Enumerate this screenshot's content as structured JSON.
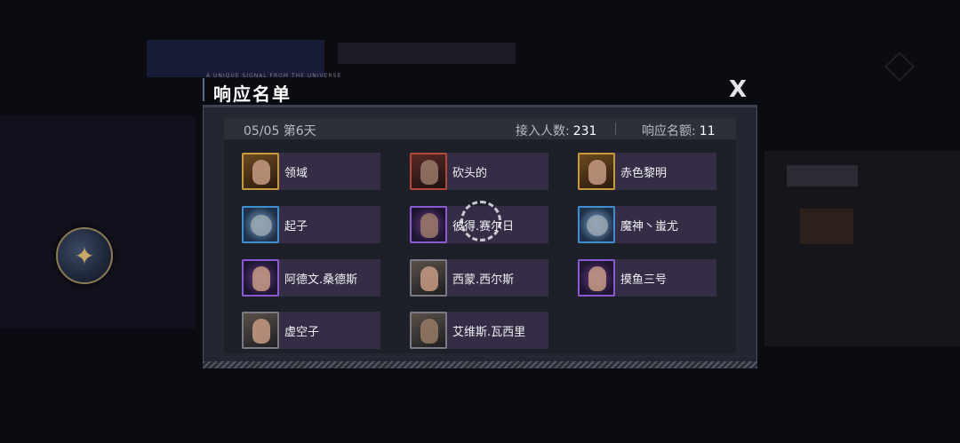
{
  "dialog": {
    "title": "响应名单",
    "tagline": "A UNIQUE SIGNAL FROM THE UNIVERSE",
    "close_label": "X"
  },
  "info": {
    "date": "05/05 第6天",
    "participants_label": "接入人数:",
    "participants_value": "231",
    "quota_label": "响应名额:",
    "quota_value": "11"
  },
  "members": [
    {
      "name": "领域"
    },
    {
      "name": "砍头的"
    },
    {
      "name": "赤色黎明"
    },
    {
      "name": "起子"
    },
    {
      "name": "彼得.赛尔日"
    },
    {
      "name": "魔神丶蚩尤"
    },
    {
      "name": "阿德文.桑德斯"
    },
    {
      "name": "西蒙.西尔斯"
    },
    {
      "name": "摸鱼三号"
    },
    {
      "name": "虚空子"
    },
    {
      "name": "艾维斯.瓦西里"
    }
  ],
  "icons": {
    "close": "close-icon",
    "side": "phoenix-emblem-icon",
    "loading": "loading-spinner-icon"
  },
  "colors": {
    "card_bg": "#352d46",
    "panel_bg": "#242631",
    "gold_frame": "#c99a3c",
    "red_frame": "#b5463a",
    "blue_frame": "#3f8fd0",
    "purple_frame": "#8a5ad0"
  }
}
